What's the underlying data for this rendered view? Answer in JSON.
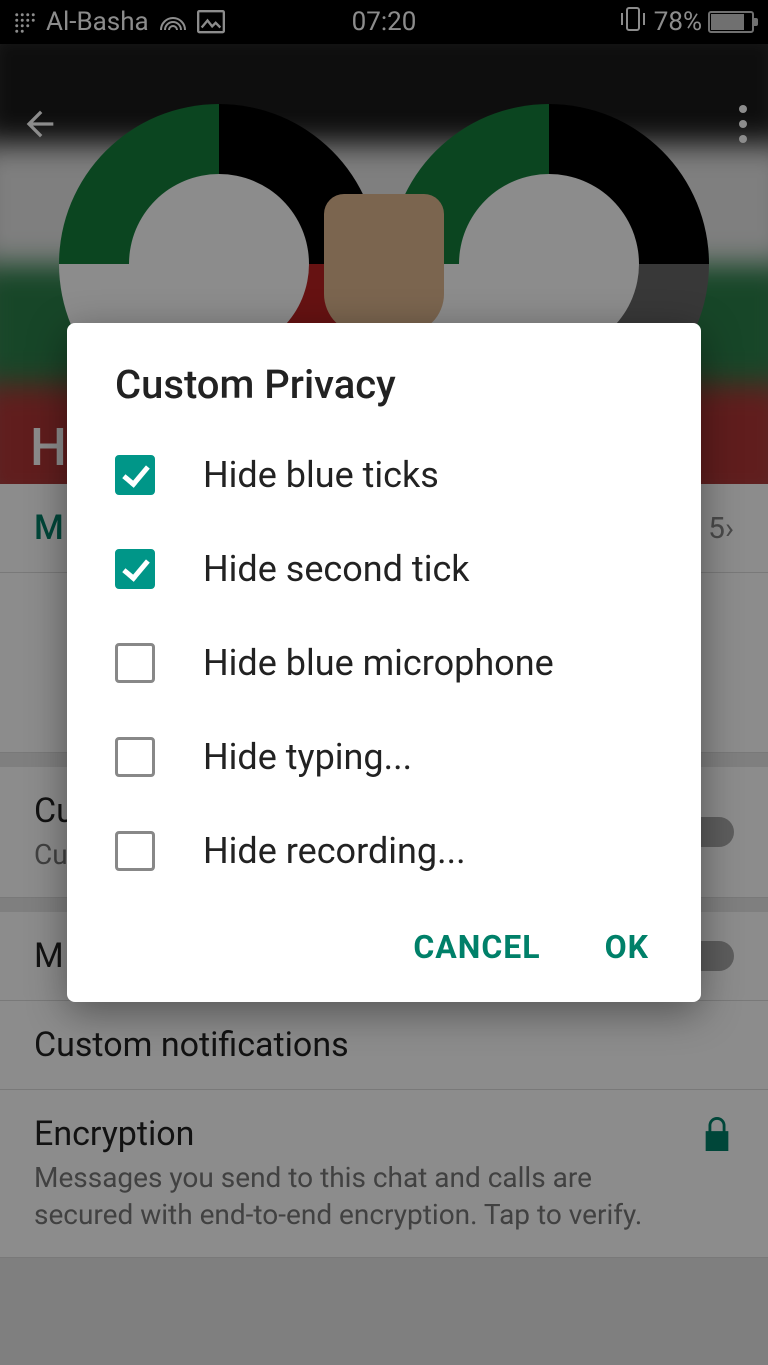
{
  "status": {
    "carrier": "Al-Basha",
    "time": "07:20",
    "battery_pct": "78%"
  },
  "header": {
    "contact_name_partial": "H"
  },
  "rows": {
    "media_label_partial": "M",
    "media_count_partial": "5 ",
    "custom_priv_title_partial": "Cu",
    "custom_priv_sub_partial": "Cu",
    "mute_label_partial": "M",
    "custom_notifications": "Custom notifications",
    "encryption_title": "Encryption",
    "encryption_body": "Messages you send to this chat and calls are secured with end-to-end encryption. Tap to verify."
  },
  "dialog": {
    "title": "Custom Privacy",
    "options": [
      {
        "label": "Hide blue ticks",
        "checked": true
      },
      {
        "label": "Hide second tick",
        "checked": true
      },
      {
        "label": "Hide blue microphone",
        "checked": false
      },
      {
        "label": "Hide typing...",
        "checked": false
      },
      {
        "label": "Hide recording...",
        "checked": false
      }
    ],
    "cancel": "CANCEL",
    "ok": "OK"
  }
}
